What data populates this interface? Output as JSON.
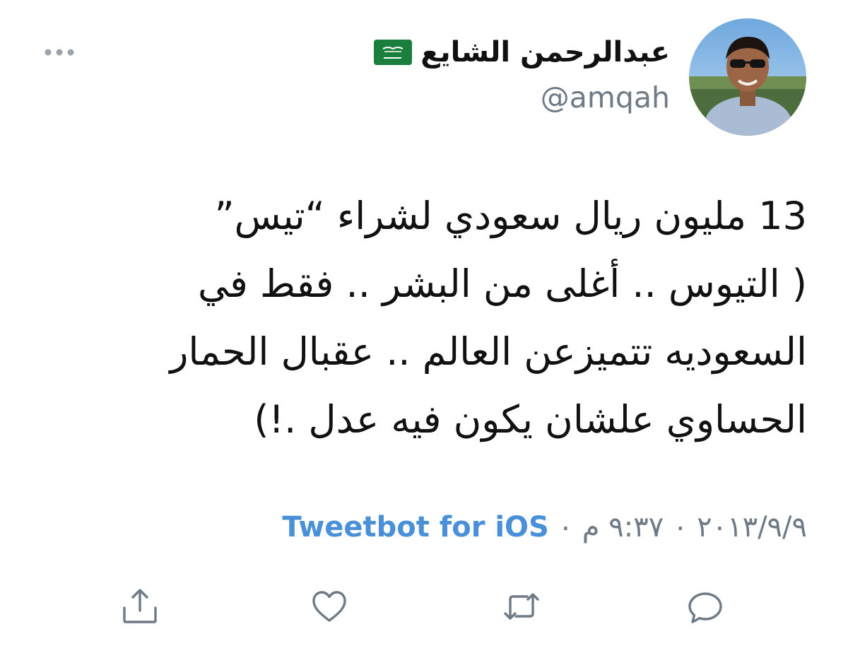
{
  "author": {
    "display_name": "عبدالرحمن الشايع",
    "handle": "@amqah",
    "flag_icon": "saudi-flag-icon",
    "avatar": "profile-photo"
  },
  "tweet": {
    "lines": [
      "13 مليون ريال سعودي لشراء “تيس”",
      "( التيوس .. أغلى من البشر .. فقط في",
      "السعوديه تتميزعن العالم .. عقبال الحمار",
      "الحساوي علشان يكون فيه عدل .!)"
    ]
  },
  "meta": {
    "date": "٢٠١٣/٩/٩",
    "separator": "٠",
    "time": "٩:٣٧ م",
    "source": "Tweetbot for iOS"
  },
  "actions": [
    {
      "icon": "reply-icon"
    },
    {
      "icon": "retweet-icon"
    },
    {
      "icon": "like-icon"
    },
    {
      "icon": "share-icon"
    }
  ],
  "colors": {
    "text": "#111111",
    "muted": "#6e7a86",
    "link": "#4a90d9",
    "icon": "#6e7a86",
    "flag_green": "#1a7f3c"
  }
}
